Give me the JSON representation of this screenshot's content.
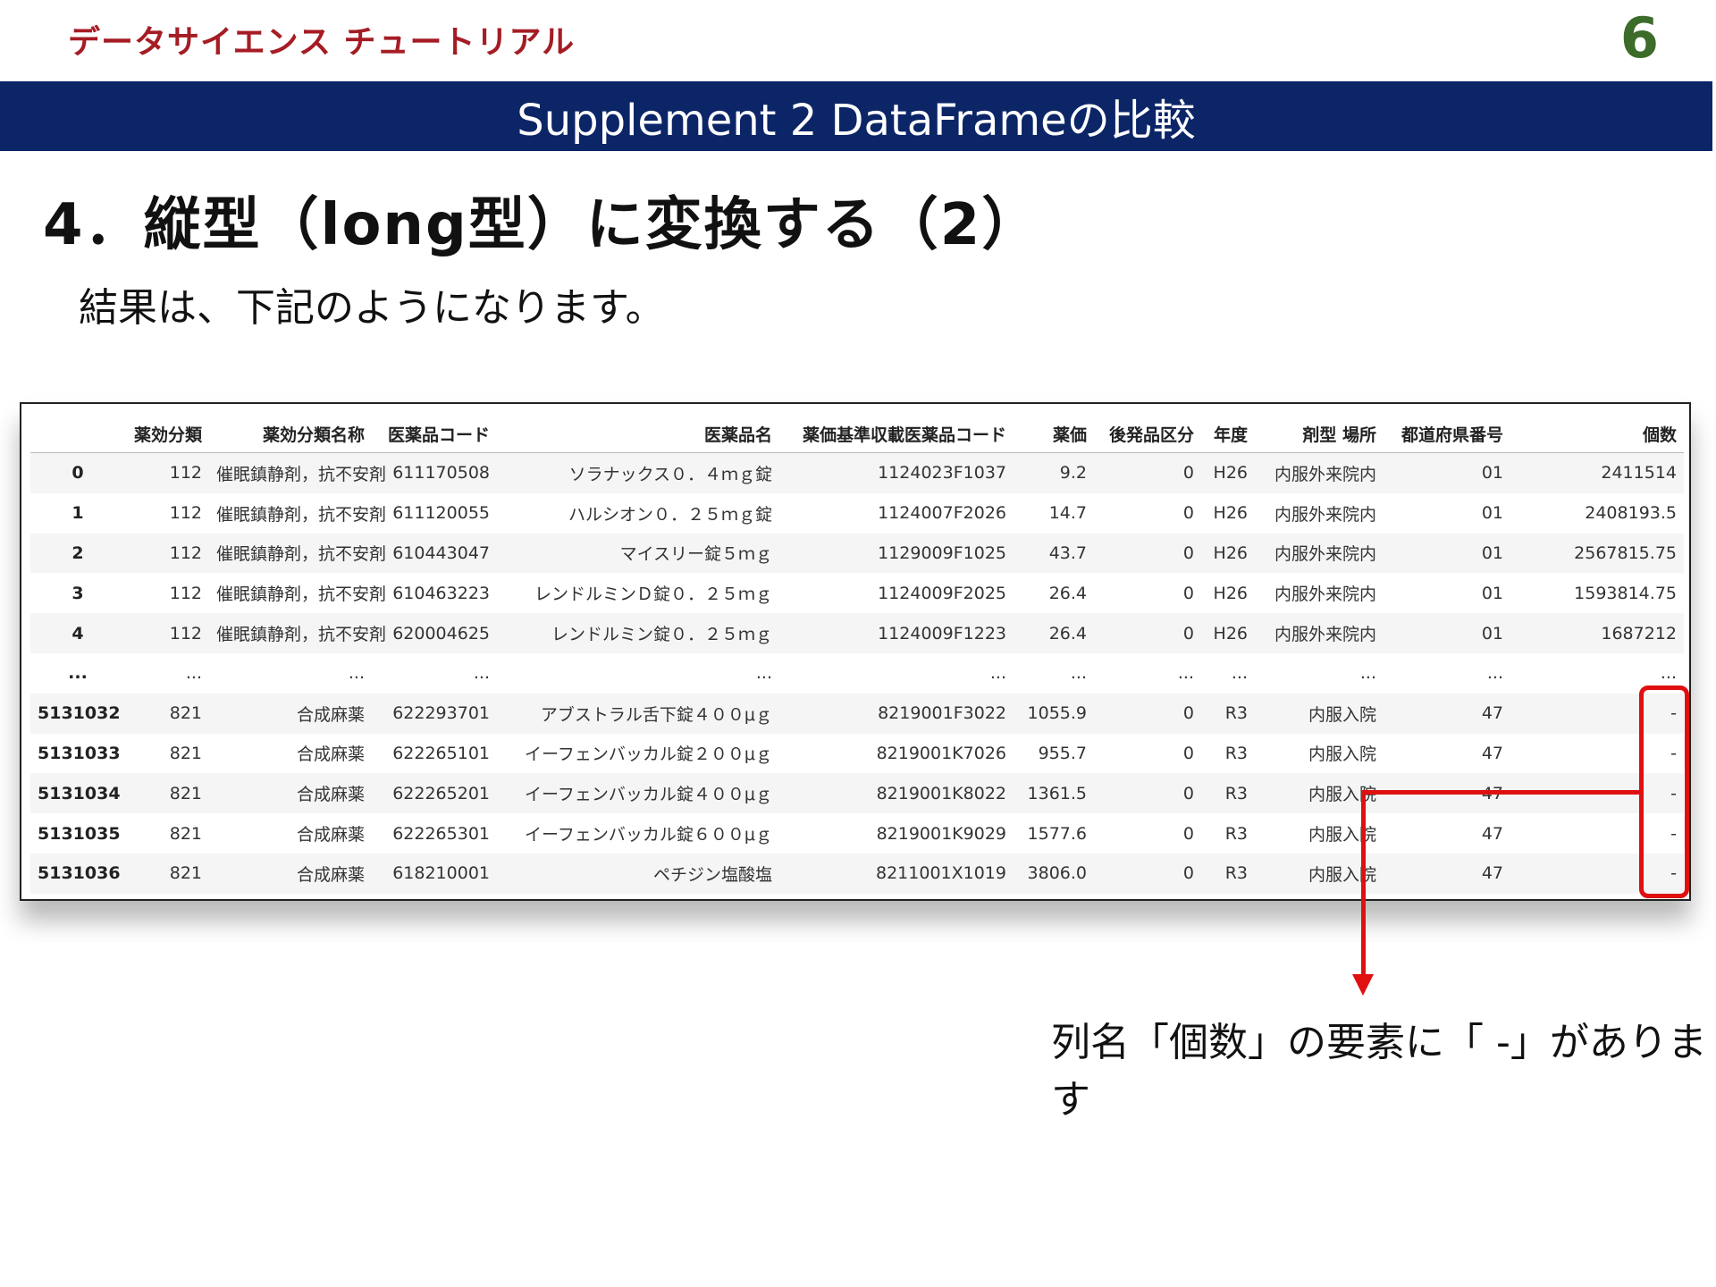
{
  "header": {
    "brand": "データサイエンス チュートリアル",
    "page_number": "6"
  },
  "banner": {
    "text": "Supplement 2 DataFrameの比較"
  },
  "slide_title": "4．縦型（long型）に変換する（2）",
  "lead_text": "結果は、下記のようになります。",
  "dataframe": {
    "columns": [
      "",
      "薬効分類",
      "薬効分類名称",
      "医薬品コード",
      "医薬品名",
      "薬価基準収載医薬品コード",
      "薬価",
      "後発品区分",
      "年度",
      "剤型 場所",
      "都道府県番号",
      "個数"
    ],
    "rows": [
      [
        "0",
        "112",
        "催眠鎮静剤，抗不安剤",
        "611170508",
        "ソラナックス０．４ｍｇ錠",
        "1124023F1037",
        "9.2",
        "0",
        "H26",
        "内服外来院内",
        "01",
        "2411514"
      ],
      [
        "1",
        "112",
        "催眠鎮静剤，抗不安剤",
        "611120055",
        "ハルシオン０．２５ｍｇ錠",
        "1124007F2026",
        "14.7",
        "0",
        "H26",
        "内服外来院内",
        "01",
        "2408193.5"
      ],
      [
        "2",
        "112",
        "催眠鎮静剤，抗不安剤",
        "610443047",
        "マイスリー錠５ｍｇ",
        "1129009F1025",
        "43.7",
        "0",
        "H26",
        "内服外来院内",
        "01",
        "2567815.75"
      ],
      [
        "3",
        "112",
        "催眠鎮静剤，抗不安剤",
        "610463223",
        "レンドルミンＤ錠０．２５ｍｇ",
        "1124009F2025",
        "26.4",
        "0",
        "H26",
        "内服外来院内",
        "01",
        "1593814.75"
      ],
      [
        "4",
        "112",
        "催眠鎮静剤，抗不安剤",
        "620004625",
        "レンドルミン錠０．２５ｍｇ",
        "1124009F1223",
        "26.4",
        "0",
        "H26",
        "内服外来院内",
        "01",
        "1687212"
      ],
      [
        "...",
        "...",
        "...",
        "...",
        "...",
        "...",
        "...",
        "...",
        "...",
        "...",
        "...",
        "..."
      ],
      [
        "5131032",
        "821",
        "合成麻薬",
        "622293701",
        "アブストラル舌下錠４００μｇ",
        "8219001F3022",
        "1055.9",
        "0",
        "R3",
        "内服入院",
        "47",
        "-"
      ],
      [
        "5131033",
        "821",
        "合成麻薬",
        "622265101",
        "イーフェンバッカル錠２００μｇ",
        "8219001K7026",
        "955.7",
        "0",
        "R3",
        "内服入院",
        "47",
        "-"
      ],
      [
        "5131034",
        "821",
        "合成麻薬",
        "622265201",
        "イーフェンバッカル錠４００μｇ",
        "8219001K8022",
        "1361.5",
        "0",
        "R3",
        "内服入院",
        "47",
        "-"
      ],
      [
        "5131035",
        "821",
        "合成麻薬",
        "622265301",
        "イーフェンバッカル錠６００μｇ",
        "8219001K9029",
        "1577.6",
        "0",
        "R3",
        "内服入院",
        "47",
        "-"
      ],
      [
        "5131036",
        "821",
        "合成麻薬",
        "618210001",
        "ペチジン塩酸塩",
        "8211001X1019",
        "3806.0",
        "0",
        "R3",
        "内服入院",
        "47",
        "-"
      ]
    ]
  },
  "annotation": {
    "text": "列名「個数」の要素に「 -」があります",
    "color": "#e01010"
  },
  "colors": {
    "banner": "#0b2567",
    "brand": "#a51c24",
    "page_number": "#3c6b2a",
    "highlight": "#e01010"
  }
}
